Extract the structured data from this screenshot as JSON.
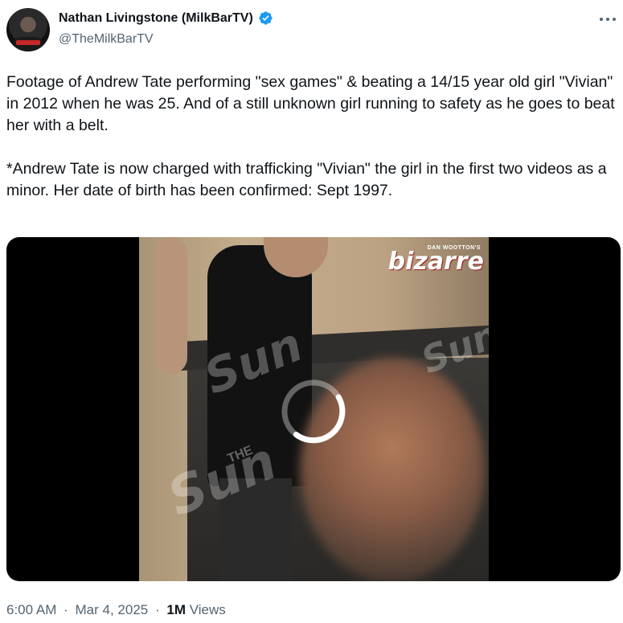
{
  "author": {
    "display_name": "Nathan Livingstone (MilkBarTV)",
    "handle": "@TheMilkBarTV",
    "verified": true
  },
  "tweet": {
    "paragraphs": [
      "Footage of Andrew Tate performing \"sex games\" & beating a 14/15 year old girl \"Vivian\" in 2012 when he was 25. And of a still unknown girl running to safety as he goes to beat her with a belt.",
      "*Andrew Tate is now charged with trafficking \"Vivian\" the girl in the first two videos as a minor. Her date of birth has been confirmed: Sept 1997."
    ]
  },
  "media": {
    "type": "video",
    "loading": true,
    "overlay_logo_small": "DAN WOOTTON'S",
    "overlay_logo": "bizarre",
    "watermark": "Sun",
    "watermark_small": "THE"
  },
  "meta": {
    "time": "6:00 AM",
    "date": "Mar 4, 2025",
    "views_count": "1M",
    "views_label": "Views",
    "separator": "·"
  },
  "icons": {
    "verified": "verified-badge-icon",
    "more": "more-options-icon",
    "spinner": "loading-spinner-icon"
  },
  "colors": {
    "verified_blue": "#1d9bf0",
    "text_primary": "#0f1419",
    "text_secondary": "#536471"
  }
}
